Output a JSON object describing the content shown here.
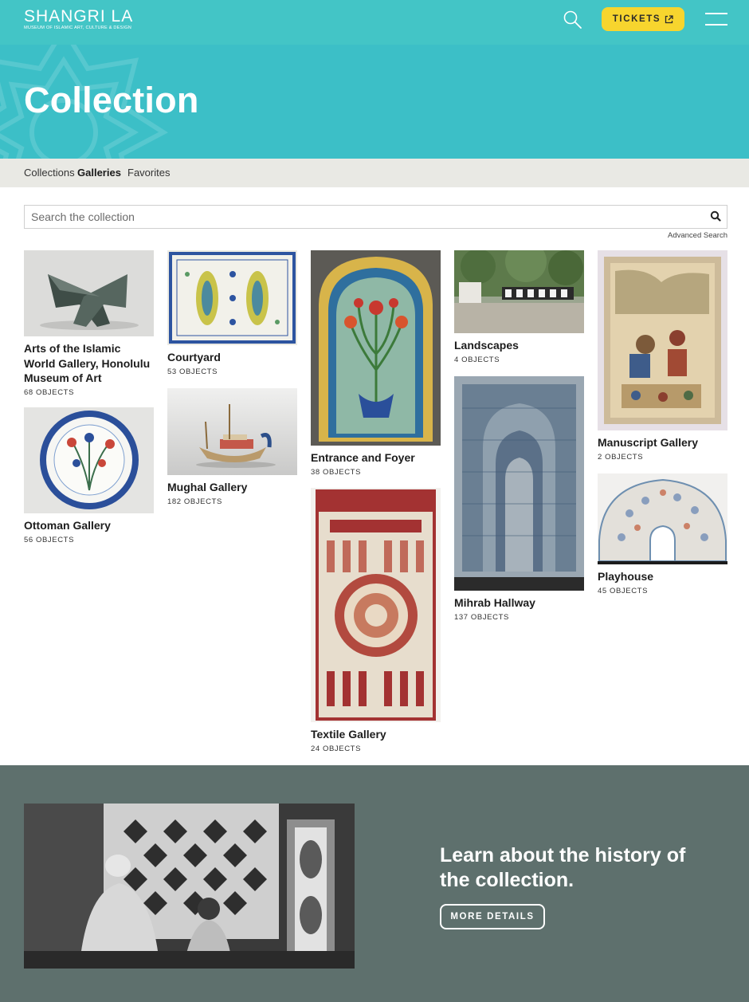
{
  "header": {
    "logo_main": "SHANGRI LA",
    "logo_sub": "Museum of Islamic Art, Culture & Design",
    "tickets_label": "TICKETS"
  },
  "hero": {
    "title": "Collection"
  },
  "subnav": {
    "items": [
      "Collections",
      "Galleries",
      "Favorites"
    ],
    "active": "Galleries"
  },
  "search": {
    "placeholder": "Search the collection",
    "advanced_label": "Advanced Search"
  },
  "galleries": [
    {
      "title": "Arts of the Islamic World Gallery, Honolulu Museum of Art",
      "count": "68 OBJECTS"
    },
    {
      "title": "Ottoman Gallery",
      "count": "56 OBJECTS"
    },
    {
      "title": "Courtyard",
      "count": "53 OBJECTS"
    },
    {
      "title": "Mughal Gallery",
      "count": "182 OBJECTS"
    },
    {
      "title": "Entrance and Foyer",
      "count": "38 OBJECTS"
    },
    {
      "title": "Textile Gallery",
      "count": "24 OBJECTS"
    },
    {
      "title": "Landscapes",
      "count": "4 OBJECTS"
    },
    {
      "title": "Mihrab Hallway",
      "count": "137 OBJECTS"
    },
    {
      "title": "Manuscript Gallery",
      "count": "2 OBJECTS"
    },
    {
      "title": "Playhouse",
      "count": "45 OBJECTS"
    }
  ],
  "footer": {
    "heading": "Learn about the history of the collection.",
    "button_label": "MORE DETAILS"
  },
  "colors": {
    "header": "#43c5c6",
    "hero": "#3cbfc7",
    "accent": "#f7d52e",
    "subnav": "#e9e9e4",
    "footer": "#5e706d"
  },
  "icons": {
    "search": "search-icon",
    "external": "external-link-icon",
    "menu": "hamburger-menu-icon"
  }
}
